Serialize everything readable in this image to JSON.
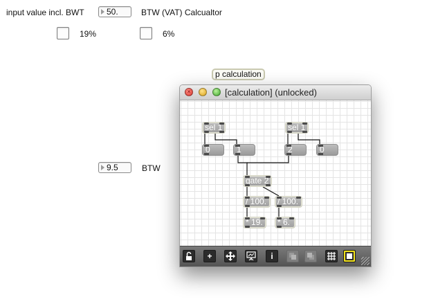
{
  "main": {
    "input_label": "input value incl. BWT",
    "input_value": "50.",
    "calc_title": "BTW (VAT) Calcualtor",
    "toggle_19_label": "19%",
    "toggle_6_label": "6%",
    "subpatch_name": "p calculation",
    "output_value": "9.5",
    "output_label": "BTW"
  },
  "window": {
    "title": "[calculation] (unlocked)",
    "close_glyph": "×"
  },
  "patch": {
    "sel1_a": "sel 1",
    "sel1_b": "sel 1",
    "msg_0a": "0",
    "msg_1": "1",
    "msg_2": "2",
    "msg_0b": "0",
    "gate": "gate 2",
    "div_a": "/ 100.",
    "div_b": "/ 100.",
    "mul_a": "* 19.",
    "mul_b": "* 6."
  },
  "toolbar": {
    "lock": "lock-icon",
    "new_object": "+",
    "move": "move-icon",
    "presentation": "presentation-icon",
    "inspector": "i",
    "grid": "grid-icon",
    "snap": "snap-icon"
  }
}
